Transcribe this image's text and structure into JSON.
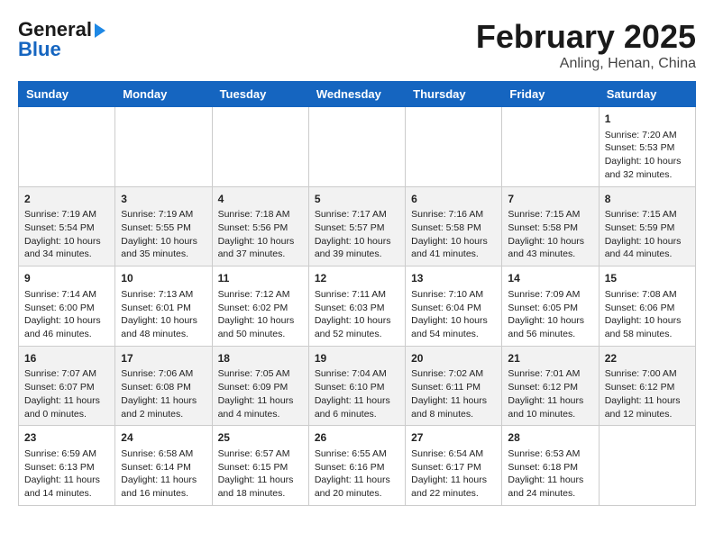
{
  "header": {
    "logo_line1": "General",
    "logo_line2": "Blue",
    "title": "February 2025",
    "subtitle": "Anling, Henan, China"
  },
  "weekdays": [
    "Sunday",
    "Monday",
    "Tuesday",
    "Wednesday",
    "Thursday",
    "Friday",
    "Saturday"
  ],
  "weeks": [
    [
      {
        "day": "",
        "info": ""
      },
      {
        "day": "",
        "info": ""
      },
      {
        "day": "",
        "info": ""
      },
      {
        "day": "",
        "info": ""
      },
      {
        "day": "",
        "info": ""
      },
      {
        "day": "",
        "info": ""
      },
      {
        "day": "1",
        "info": "Sunrise: 7:20 AM\nSunset: 5:53 PM\nDaylight: 10 hours and 32 minutes."
      }
    ],
    [
      {
        "day": "2",
        "info": "Sunrise: 7:19 AM\nSunset: 5:54 PM\nDaylight: 10 hours and 34 minutes."
      },
      {
        "day": "3",
        "info": "Sunrise: 7:19 AM\nSunset: 5:55 PM\nDaylight: 10 hours and 35 minutes."
      },
      {
        "day": "4",
        "info": "Sunrise: 7:18 AM\nSunset: 5:56 PM\nDaylight: 10 hours and 37 minutes."
      },
      {
        "day": "5",
        "info": "Sunrise: 7:17 AM\nSunset: 5:57 PM\nDaylight: 10 hours and 39 minutes."
      },
      {
        "day": "6",
        "info": "Sunrise: 7:16 AM\nSunset: 5:58 PM\nDaylight: 10 hours and 41 minutes."
      },
      {
        "day": "7",
        "info": "Sunrise: 7:15 AM\nSunset: 5:58 PM\nDaylight: 10 hours and 43 minutes."
      },
      {
        "day": "8",
        "info": "Sunrise: 7:15 AM\nSunset: 5:59 PM\nDaylight: 10 hours and 44 minutes."
      }
    ],
    [
      {
        "day": "9",
        "info": "Sunrise: 7:14 AM\nSunset: 6:00 PM\nDaylight: 10 hours and 46 minutes."
      },
      {
        "day": "10",
        "info": "Sunrise: 7:13 AM\nSunset: 6:01 PM\nDaylight: 10 hours and 48 minutes."
      },
      {
        "day": "11",
        "info": "Sunrise: 7:12 AM\nSunset: 6:02 PM\nDaylight: 10 hours and 50 minutes."
      },
      {
        "day": "12",
        "info": "Sunrise: 7:11 AM\nSunset: 6:03 PM\nDaylight: 10 hours and 52 minutes."
      },
      {
        "day": "13",
        "info": "Sunrise: 7:10 AM\nSunset: 6:04 PM\nDaylight: 10 hours and 54 minutes."
      },
      {
        "day": "14",
        "info": "Sunrise: 7:09 AM\nSunset: 6:05 PM\nDaylight: 10 hours and 56 minutes."
      },
      {
        "day": "15",
        "info": "Sunrise: 7:08 AM\nSunset: 6:06 PM\nDaylight: 10 hours and 58 minutes."
      }
    ],
    [
      {
        "day": "16",
        "info": "Sunrise: 7:07 AM\nSunset: 6:07 PM\nDaylight: 11 hours and 0 minutes."
      },
      {
        "day": "17",
        "info": "Sunrise: 7:06 AM\nSunset: 6:08 PM\nDaylight: 11 hours and 2 minutes."
      },
      {
        "day": "18",
        "info": "Sunrise: 7:05 AM\nSunset: 6:09 PM\nDaylight: 11 hours and 4 minutes."
      },
      {
        "day": "19",
        "info": "Sunrise: 7:04 AM\nSunset: 6:10 PM\nDaylight: 11 hours and 6 minutes."
      },
      {
        "day": "20",
        "info": "Sunrise: 7:02 AM\nSunset: 6:11 PM\nDaylight: 11 hours and 8 minutes."
      },
      {
        "day": "21",
        "info": "Sunrise: 7:01 AM\nSunset: 6:12 PM\nDaylight: 11 hours and 10 minutes."
      },
      {
        "day": "22",
        "info": "Sunrise: 7:00 AM\nSunset: 6:12 PM\nDaylight: 11 hours and 12 minutes."
      }
    ],
    [
      {
        "day": "23",
        "info": "Sunrise: 6:59 AM\nSunset: 6:13 PM\nDaylight: 11 hours and 14 minutes."
      },
      {
        "day": "24",
        "info": "Sunrise: 6:58 AM\nSunset: 6:14 PM\nDaylight: 11 hours and 16 minutes."
      },
      {
        "day": "25",
        "info": "Sunrise: 6:57 AM\nSunset: 6:15 PM\nDaylight: 11 hours and 18 minutes."
      },
      {
        "day": "26",
        "info": "Sunrise: 6:55 AM\nSunset: 6:16 PM\nDaylight: 11 hours and 20 minutes."
      },
      {
        "day": "27",
        "info": "Sunrise: 6:54 AM\nSunset: 6:17 PM\nDaylight: 11 hours and 22 minutes."
      },
      {
        "day": "28",
        "info": "Sunrise: 6:53 AM\nSunset: 6:18 PM\nDaylight: 11 hours and 24 minutes."
      },
      {
        "day": "",
        "info": ""
      }
    ]
  ]
}
